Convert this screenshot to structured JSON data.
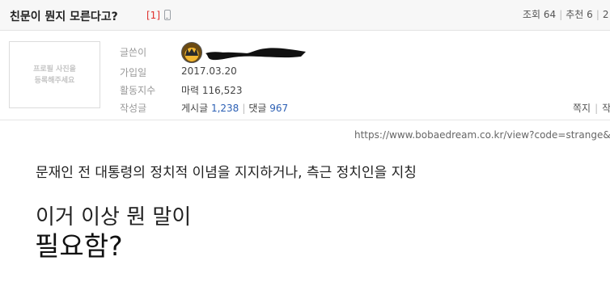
{
  "post": {
    "title": "친문이 뭔지 모른다고?",
    "comment_count": "[1]",
    "mobile_icon": "mobile-phone-icon"
  },
  "stats": {
    "views_label": "조회",
    "views": "64",
    "recommend_label": "추천",
    "recommend": "6",
    "third": "2"
  },
  "profile": {
    "photo_placeholder": "프로필 사진을\n등록해주세요",
    "author_label": "글쓴이",
    "joined_label": "가입일",
    "joined": "2017.03.20",
    "activity_label": "활동지수",
    "activity": "마력 116,523",
    "written_label": "작성글",
    "posts_label": "게시글",
    "posts": "1,238",
    "comments_label": "댓글",
    "comments": "967"
  },
  "actions": {
    "message": "쪽지",
    "more": "작"
  },
  "content": {
    "source_url": "https://www.bobaedream.co.kr/view?code=strange&No",
    "line1": "문재인 전 대통령의 정치적 이념을 지지하거나, 측근 정치인을 지칭",
    "line2": "이거 이상 뭔 말이",
    "line3": "필요함?"
  },
  "colors": {
    "comment_count": "#e0302c",
    "link_blue": "#2b5fb4"
  }
}
